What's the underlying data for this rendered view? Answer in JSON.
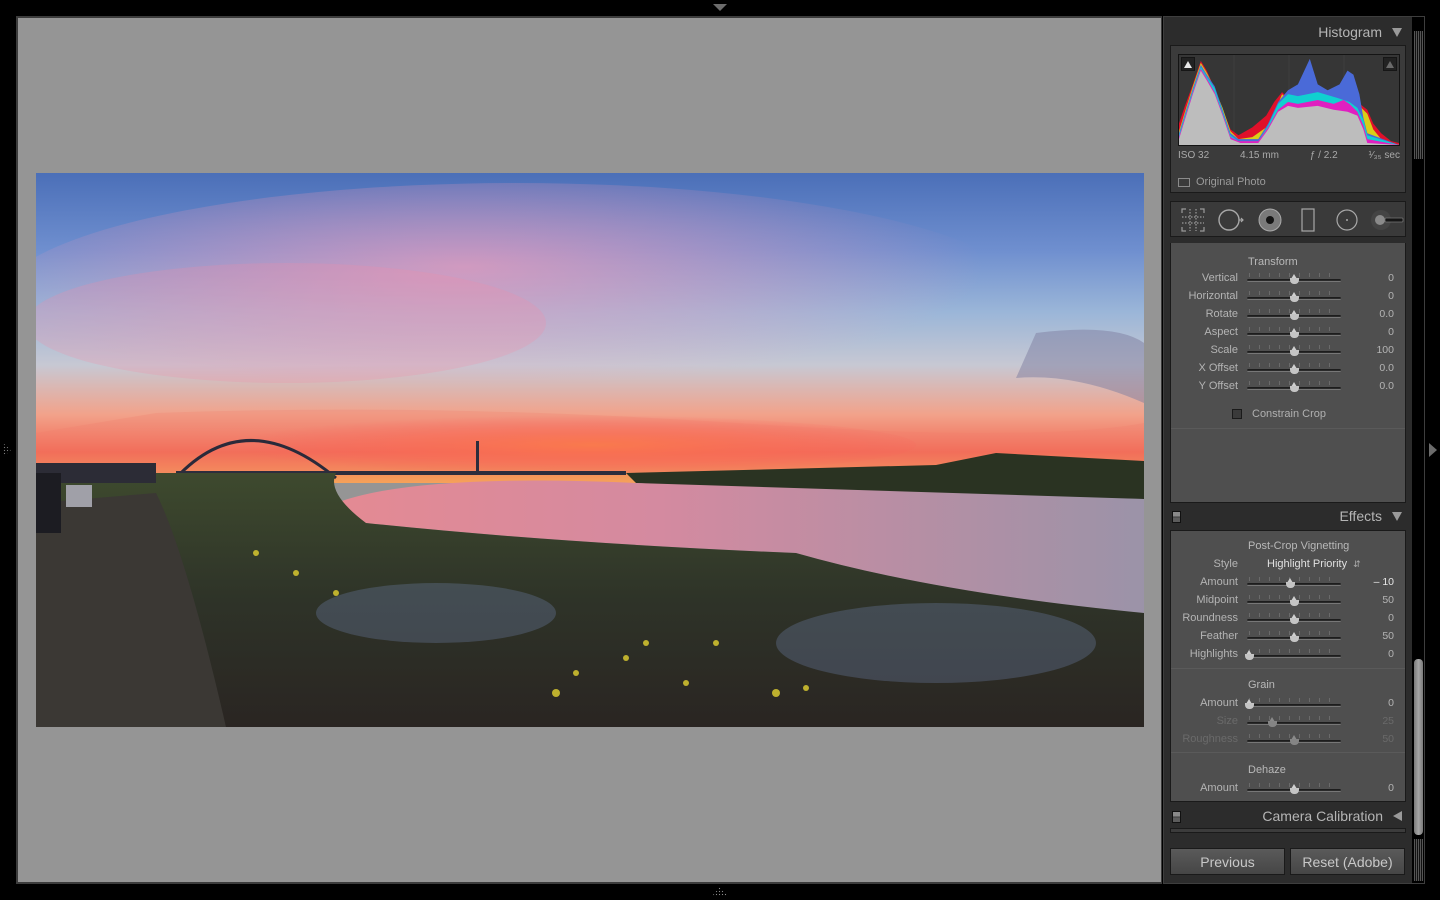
{
  "histogram": {
    "title": "Histogram",
    "exif": {
      "iso": "ISO 32",
      "focal_length": "4.15 mm",
      "aperture": "ƒ / 2.2",
      "shutter": "¹⁄₃₅ sec"
    },
    "original_photo_label": "Original Photo",
    "original_photo_checked": false,
    "colors": {
      "gray": "#bdbdbd",
      "yellow": "#d8cf18",
      "cyan": "#10d0d0",
      "blue": "#4a6ad8",
      "magenta": "#e020c0",
      "red": "#e0102a",
      "green": "#20b040"
    }
  },
  "tool_strip": {
    "tools": [
      {
        "name": "crop-overlay-tool",
        "label": "Crop Overlay"
      },
      {
        "name": "spot-removal-tool",
        "label": "Spot Removal"
      },
      {
        "name": "red-eye-tool",
        "label": "Red Eye Correction"
      },
      {
        "name": "graduated-filter-tool",
        "label": "Graduated Filter"
      },
      {
        "name": "radial-filter-tool",
        "label": "Radial Filter"
      },
      {
        "name": "adjustment-brush-tool",
        "label": "Adjustment Brush"
      }
    ]
  },
  "transform": {
    "title": "Transform",
    "sliders": [
      {
        "label": "Vertical",
        "value": "0",
        "position": 0.5
      },
      {
        "label": "Horizontal",
        "value": "0",
        "position": 0.5
      },
      {
        "label": "Rotate",
        "value": "0.0",
        "position": 0.5
      },
      {
        "label": "Aspect",
        "value": "0",
        "position": 0.5
      },
      {
        "label": "Scale",
        "value": "100",
        "position": 0.5
      },
      {
        "label": "X Offset",
        "value": "0.0",
        "position": 0.5
      },
      {
        "label": "Y Offset",
        "value": "0.0",
        "position": 0.5
      }
    ],
    "constrain_crop_label": "Constrain Crop",
    "constrain_crop_checked": false
  },
  "effects": {
    "title": "Effects",
    "vignetting": {
      "title": "Post-Crop Vignetting",
      "style_label": "Style",
      "style_value": "Highlight Priority",
      "sliders": [
        {
          "label": "Amount",
          "value": "– 10",
          "position": 0.45,
          "highlighted": true
        },
        {
          "label": "Midpoint",
          "value": "50",
          "position": 0.5
        },
        {
          "label": "Roundness",
          "value": "0",
          "position": 0.5
        },
        {
          "label": "Feather",
          "value": "50",
          "position": 0.5
        },
        {
          "label": "Highlights",
          "value": "0",
          "position": 0.0
        }
      ]
    },
    "grain": {
      "title": "Grain",
      "sliders": [
        {
          "label": "Amount",
          "value": "0",
          "position": 0.0,
          "disabled": false
        },
        {
          "label": "Size",
          "value": "25",
          "position": 0.25,
          "disabled": true
        },
        {
          "label": "Roughness",
          "value": "50",
          "position": 0.5,
          "disabled": true
        }
      ]
    },
    "dehaze": {
      "title": "Dehaze",
      "sliders": [
        {
          "label": "Amount",
          "value": "0",
          "position": 0.5
        }
      ]
    }
  },
  "camera_calibration": {
    "title": "Camera Calibration"
  },
  "buttons": {
    "previous": "Previous",
    "reset": "Reset (Adobe)"
  },
  "scroll": {
    "position_fraction": 0.78
  }
}
